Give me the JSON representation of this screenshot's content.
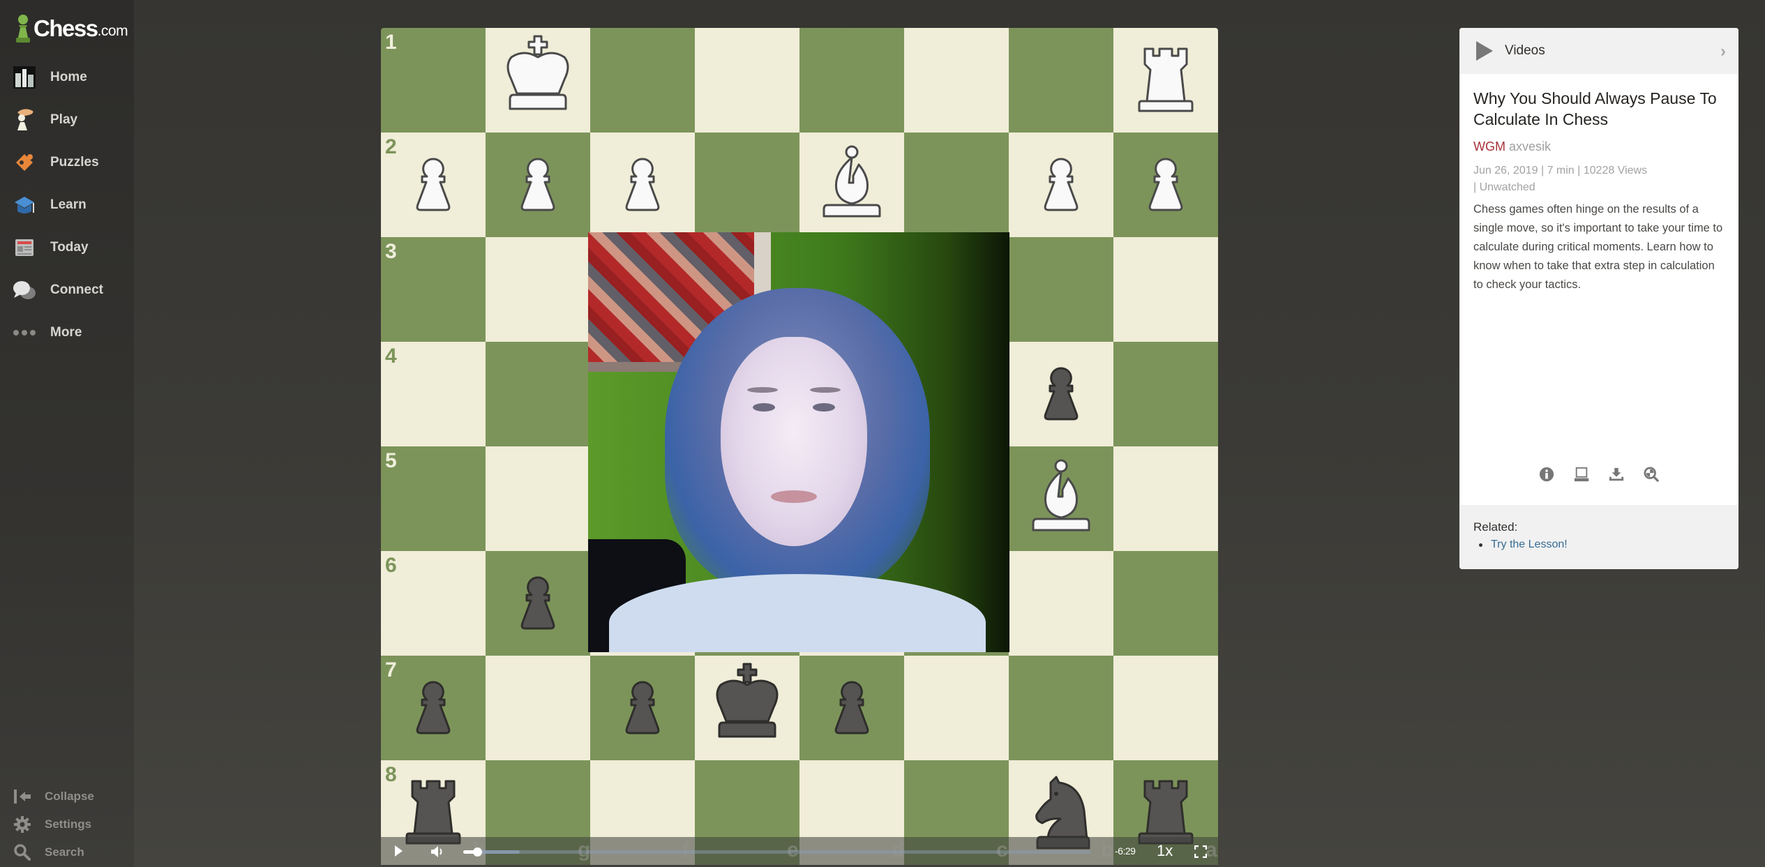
{
  "brand": {
    "name": "Chess",
    "tld": ".com",
    "accent": "#81b64c"
  },
  "sidebar": {
    "items": [
      {
        "label": "Home",
        "icon": "home-icon"
      },
      {
        "label": "Play",
        "icon": "play-hand-icon"
      },
      {
        "label": "Puzzles",
        "icon": "puzzle-icon"
      },
      {
        "label": "Learn",
        "icon": "graduation-cap-icon"
      },
      {
        "label": "Today",
        "icon": "newspaper-icon"
      },
      {
        "label": "Connect",
        "icon": "chat-bubbles-icon"
      },
      {
        "label": "More",
        "icon": "more-dots-icon"
      }
    ],
    "bottom": [
      {
        "label": "Collapse",
        "icon": "collapse-icon"
      },
      {
        "label": "Settings",
        "icon": "gear-icon"
      },
      {
        "label": "Search",
        "icon": "search-icon"
      }
    ]
  },
  "board": {
    "orientation": "black",
    "colors": {
      "light": "#f0edd8",
      "dark": "#7c945a"
    },
    "rank_labels": [
      "1",
      "2",
      "3",
      "4",
      "5",
      "6",
      "7",
      "8"
    ],
    "file_labels": [
      "h",
      "g",
      "f",
      "e",
      "d",
      "c",
      "b",
      "a"
    ],
    "pieces": [
      {
        "square": "g1",
        "piece": "K",
        "color": "white"
      },
      {
        "square": "a1",
        "piece": "R",
        "color": "white"
      },
      {
        "square": "h2",
        "piece": "P",
        "color": "white"
      },
      {
        "square": "g2",
        "piece": "P",
        "color": "white"
      },
      {
        "square": "f2",
        "piece": "P",
        "color": "white"
      },
      {
        "square": "d2",
        "piece": "B",
        "color": "white"
      },
      {
        "square": "b2",
        "piece": "P",
        "color": "white"
      },
      {
        "square": "a2",
        "piece": "P",
        "color": "white"
      },
      {
        "square": "b4",
        "piece": "P",
        "color": "black"
      },
      {
        "square": "b5",
        "piece": "B",
        "color": "white"
      },
      {
        "square": "g6",
        "piece": "P",
        "color": "black"
      },
      {
        "square": "h7",
        "piece": "P",
        "color": "black"
      },
      {
        "square": "f7",
        "piece": "P",
        "color": "black"
      },
      {
        "square": "e7",
        "piece": "K",
        "color": "black"
      },
      {
        "square": "d7",
        "piece": "P",
        "color": "black"
      },
      {
        "square": "h8",
        "piece": "R",
        "color": "black"
      },
      {
        "square": "b8",
        "piece": "N",
        "color": "black"
      },
      {
        "square": "a8",
        "piece": "R",
        "color": "black"
      }
    ]
  },
  "player": {
    "play_icon": "play-icon",
    "volume_icon": "volume-icon",
    "fullscreen_icon": "fullscreen-icon",
    "time_remaining": "-6:29",
    "speed": "1x",
    "progress_fraction": 0.022,
    "buffered_fraction": 0.09,
    "total_duration": "7 min"
  },
  "panel": {
    "header": {
      "title": "Videos",
      "icon": "play-triangle-icon",
      "chevron": "›"
    },
    "video_title": "Why You Should Always Pause To Calculate In Chess",
    "author_title": "WGM",
    "author_name": "axvesik",
    "meta_line1": "Jun 26, 2019 |  7 min |  10228 Views",
    "meta_line2": " |  Unwatched",
    "description": "Chess games often hinge on the results of a single move, so it's important to take your time to calculate during critical moments. Learn how to know when to take that extra step in calculation to check your tactics.",
    "actions": [
      {
        "icon": "info-icon"
      },
      {
        "icon": "laptop-icon"
      },
      {
        "icon": "download-icon"
      },
      {
        "icon": "analysis-search-icon"
      }
    ],
    "related_label": "Related:",
    "related_links": [
      {
        "label": "Try the Lesson!"
      }
    ],
    "colors": {
      "wgm": "#a7323a",
      "link": "#356b92"
    }
  }
}
